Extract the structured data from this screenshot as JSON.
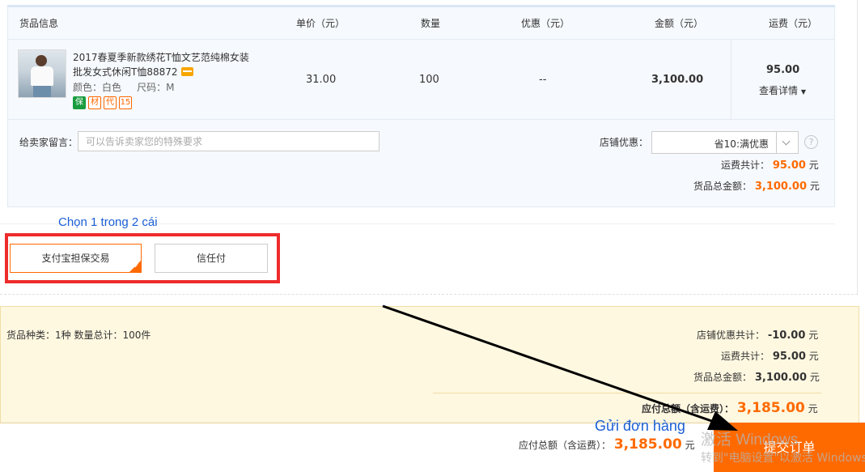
{
  "table": {
    "headers": {
      "product": "货品信息",
      "unit_price": "单价（元）",
      "quantity": "数量",
      "discount": "优惠（元）",
      "amount": "金额（元）",
      "freight": "运费（元）"
    },
    "item": {
      "title": "2017春夏季新款绣花T恤文艺范纯棉女装批发女式休闲T恤88872",
      "color": "颜色：白色",
      "size": "尺码：M",
      "badges": [
        "保",
        "材",
        "代",
        "15"
      ],
      "unit_price": "31.00",
      "quantity": "100",
      "discount": "--",
      "amount": "3,100.00",
      "freight": "95.00",
      "detail_link": "查看详情"
    }
  },
  "message": {
    "label": "给卖家留言：",
    "placeholder": "可以告诉卖家您的特殊要求",
    "value": ""
  },
  "shop_discount": {
    "label": "店铺优惠：",
    "selected": "省10:满优惠"
  },
  "shop_summary": {
    "freight_label": "运费共计：",
    "freight_value": "95.00",
    "goods_label": "货品总金额：",
    "goods_value": "3,100.00",
    "unit": "元"
  },
  "annotations": {
    "choose": "Chọn 1 trong 2 cái",
    "send": "Gửi đơn hàng"
  },
  "payment": {
    "option1": "支付宝担保交易",
    "option2": "信任付",
    "selected": "支付宝担保交易"
  },
  "totals": {
    "stats": "货品种类：1种   数量总计：100件",
    "discount_label": "店铺优惠共计：",
    "discount_value": "-10.00",
    "freight_label": "运费共计：",
    "freight_value": "95.00",
    "goods_label": "货品总金额：",
    "goods_value": "3,100.00",
    "payable_label": "应付总额（含运费）：",
    "payable_value": "3,185.00",
    "unit": "元"
  },
  "footer": {
    "payable_label": "应付总额（含运费）：",
    "payable_value": "3,185.00",
    "unit": "元",
    "submit": "提交订单"
  },
  "watermark": {
    "line1": "激活 Windows",
    "line2": "转到\"电脑设置\"以激活 Windows。"
  },
  "colors": {
    "accent": "#ff6a00",
    "annotation": "#1a5fd6",
    "highlight_frame": "#ee2b2b",
    "summary_bg": "#fff8e1"
  }
}
